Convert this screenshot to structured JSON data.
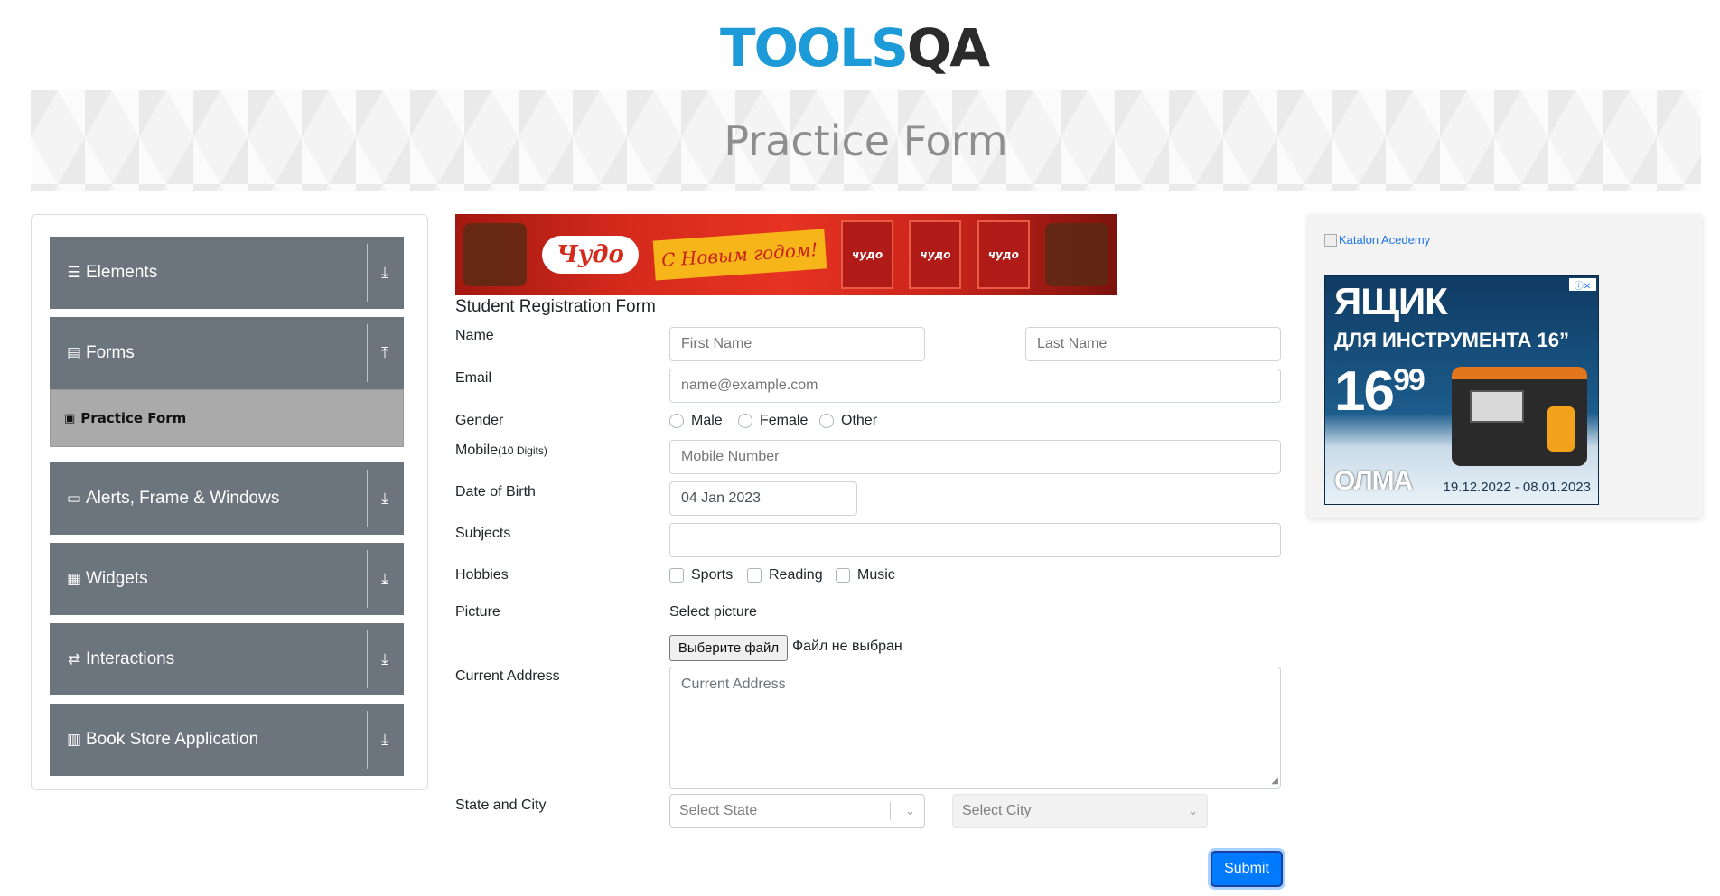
{
  "header": {
    "logo_tools": "TOOLS",
    "logo_qa": "QA"
  },
  "banner": {
    "title": "Practice Form"
  },
  "sidebar": {
    "groups": [
      {
        "label": "Elements",
        "icon": "list-icon",
        "arrow": "download-arrow-icon"
      },
      {
        "label": "Forms",
        "icon": "form-icon",
        "arrow": "upload-arrow-icon"
      },
      {
        "label": "Alerts, Frame & Windows",
        "icon": "window-icon",
        "arrow": "download-arrow-icon"
      },
      {
        "label": "Widgets",
        "icon": "widgets-icon",
        "arrow": "download-arrow-icon"
      },
      {
        "label": "Interactions",
        "icon": "interactions-icon",
        "arrow": "download-arrow-icon"
      },
      {
        "label": "Book Store Application",
        "icon": "books-icon",
        "arrow": "download-arrow-icon"
      }
    ],
    "active_item": "Practice Form"
  },
  "ad_top": {
    "brand": "Чудо",
    "greeting": "С Новым годом!",
    "pack_label": "чудо"
  },
  "form": {
    "title": "Student Registration Form",
    "labels": {
      "name": "Name",
      "email": "Email",
      "gender": "Gender",
      "mobile": "Mobile",
      "mobile_hint": "(10 Digits)",
      "dob": "Date of Birth",
      "subjects": "Subjects",
      "hobbies": "Hobbies",
      "picture": "Picture",
      "address": "Current Address",
      "state_city": "State and City"
    },
    "placeholders": {
      "first_name": "First Name",
      "last_name": "Last Name",
      "email": "name@example.com",
      "mobile": "Mobile Number",
      "address": "Current Address",
      "state": "Select State",
      "city": "Select City"
    },
    "dob_value": "04 Jan 2023",
    "gender_options": [
      "Male",
      "Female",
      "Other"
    ],
    "hobby_options": [
      "Sports",
      "Reading",
      "Music"
    ],
    "picture": {
      "caption": "Select picture",
      "button": "Выберите файл",
      "status": "Файл не выбран"
    },
    "submit": "Submit"
  },
  "right_ads": {
    "katalon_alt": "Katalon Acedemy",
    "olma": {
      "headline": "ЯЩИК",
      "subheadline": "ДЛЯ ИНСТРУМЕНТА 16”",
      "price_main": "16",
      "price_cents": "99",
      "brand": "ОЛМА",
      "dates": "19.12.2022 - 08.01.2023"
    }
  },
  "colors": {
    "sidebar_group": "#6c757d",
    "sidebar_active": "#aaaaaa",
    "primary_button": "#007bff",
    "logo_blue": "#1d9ad8"
  }
}
